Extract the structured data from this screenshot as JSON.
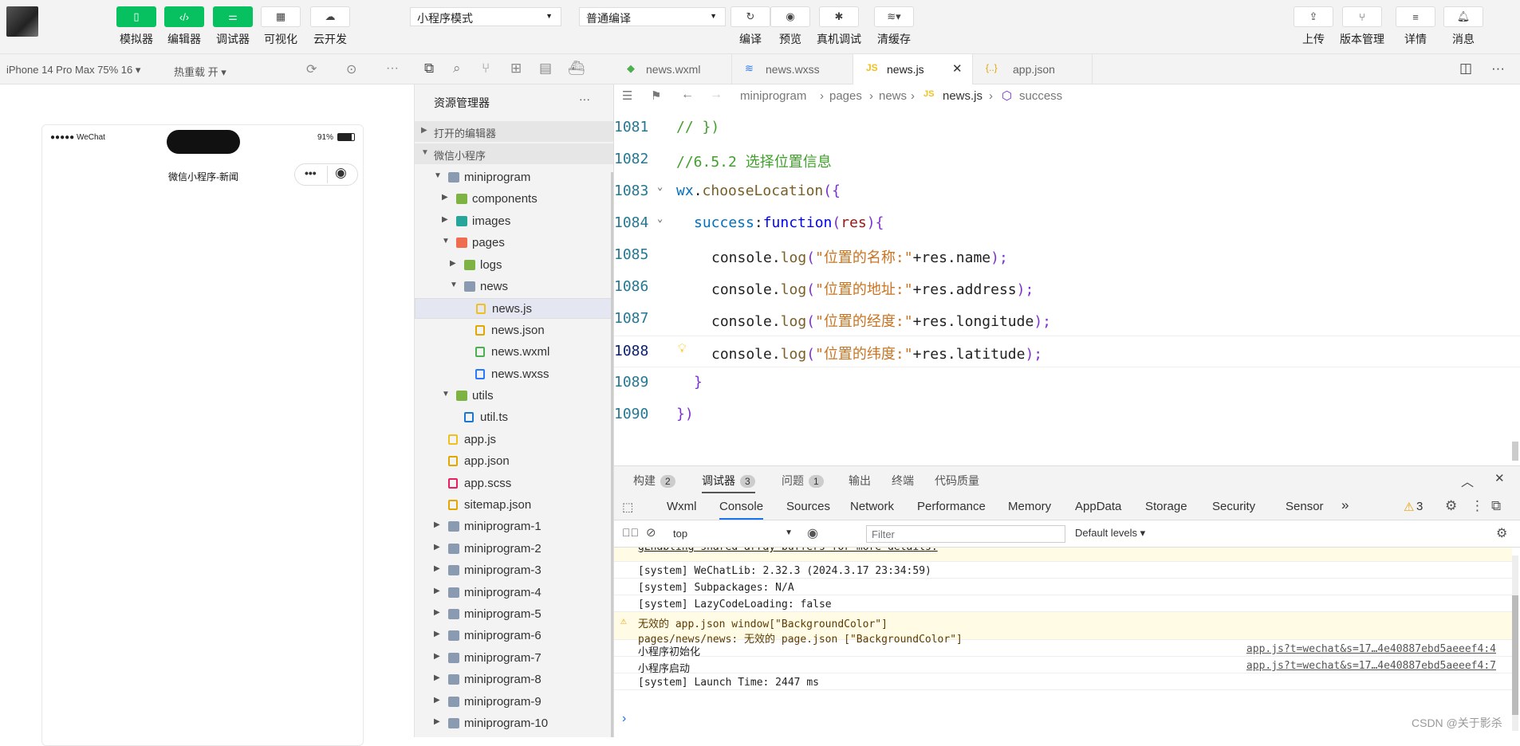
{
  "toolbar": {
    "simulator": "模拟器",
    "editor": "编辑器",
    "debugger": "调试器",
    "visual": "可视化",
    "cloud": "云开发",
    "mode": "小程序模式",
    "compile_mode": "普通编译",
    "compile": "编译",
    "preview": "预览",
    "remote_debug": "真机调试",
    "clear_cache": "清缓存",
    "upload": "上传",
    "version": "版本管理",
    "details": "详情",
    "messages": "消息"
  },
  "device_bar": {
    "device": "iPhone 14 Pro Max 75% 16 ▾",
    "hot_reload": "热重载 开 ▾"
  },
  "phone": {
    "carrier": "●●●●● WeChat",
    "battery": "91%",
    "title": "微信小程序-新闻",
    "menu": "•••"
  },
  "explorer": {
    "title": "资源管理器",
    "more": "···",
    "open_editors": "打开的编辑器",
    "project": "微信小程序",
    "items": [
      {
        "label": "miniprogram",
        "arrow": "▼",
        "icon": "folder"
      },
      {
        "label": "components",
        "arrow": "▶",
        "icon": "folder-green"
      },
      {
        "label": "images",
        "arrow": "▶",
        "icon": "folder-teal"
      },
      {
        "label": "pages",
        "arrow": "▼",
        "icon": "folder-red"
      },
      {
        "label": "logs",
        "arrow": "▶",
        "icon": "folder-green"
      },
      {
        "label": "news",
        "arrow": "▼",
        "icon": "folder"
      },
      {
        "label": "news.js",
        "arrow": "",
        "icon": "js"
      },
      {
        "label": "news.json",
        "arrow": "",
        "icon": "json"
      },
      {
        "label": "news.wxml",
        "arrow": "",
        "icon": "wxml"
      },
      {
        "label": "news.wxss",
        "arrow": "",
        "icon": "wxss"
      },
      {
        "label": "utils",
        "arrow": "▼",
        "icon": "folder-green"
      },
      {
        "label": "util.ts",
        "arrow": "",
        "icon": "ts"
      },
      {
        "label": "app.js",
        "arrow": "",
        "icon": "js"
      },
      {
        "label": "app.json",
        "arrow": "",
        "icon": "json"
      },
      {
        "label": "app.scss",
        "arrow": "",
        "icon": "scss"
      },
      {
        "label": "sitemap.json",
        "arrow": "",
        "icon": "json"
      },
      {
        "label": "miniprogram-1",
        "arrow": "▶",
        "icon": "folder"
      },
      {
        "label": "miniprogram-2",
        "arrow": "▶",
        "icon": "folder"
      },
      {
        "label": "miniprogram-3",
        "arrow": "▶",
        "icon": "folder"
      },
      {
        "label": "miniprogram-4",
        "arrow": "▶",
        "icon": "folder"
      },
      {
        "label": "miniprogram-5",
        "arrow": "▶",
        "icon": "folder"
      },
      {
        "label": "miniprogram-6",
        "arrow": "▶",
        "icon": "folder"
      },
      {
        "label": "miniprogram-7",
        "arrow": "▶",
        "icon": "folder"
      },
      {
        "label": "miniprogram-8",
        "arrow": "▶",
        "icon": "folder"
      },
      {
        "label": "miniprogram-9",
        "arrow": "▶",
        "icon": "folder"
      },
      {
        "label": "miniprogram-10",
        "arrow": "▶",
        "icon": "folder"
      }
    ]
  },
  "tabs": [
    {
      "label": "news.wxml"
    },
    {
      "label": "news.wxss"
    },
    {
      "label": "news.js"
    },
    {
      "label": "app.json"
    }
  ],
  "breadcrumb": {
    "p1": "miniprogram",
    "p2": "pages",
    "p3": "news",
    "p4": "news.js",
    "p5": "success"
  },
  "code": {
    "l1081": "1081",
    "l1082": "1082",
    "l1083": "1083",
    "l1084": "1084",
    "l1085": "1085",
    "l1086": "1086",
    "l1087": "1087",
    "l1088": "1088",
    "l1089": "1089",
    "l1090": "1090",
    "c1081": "// })",
    "c1082": "//6.5.2 选择位置信息",
    "wx": "wx",
    "dot": ".",
    "choose": "chooseLocation",
    "open": "({",
    "success": "success",
    "colon": ":",
    "function": "function",
    "paren": "(",
    "res": "res",
    "close_brace": "){",
    "console": "console",
    "log": "log",
    "lp": "(",
    "s1": "\"位置的名称:\"",
    "s2": "\"位置的地址:\"",
    "s3": "\"位置的经度:\"",
    "s4": "\"位置的纬度:\"",
    "plus_res": "+res.",
    "name": "name",
    "address": "address",
    "longitude": "longitude",
    "latitude": "latitude",
    "end": ");",
    "rbrace": "}",
    "rparen": "})"
  },
  "panel": {
    "build": "构建",
    "build_count": "2",
    "debugger": "调试器",
    "debugger_count": "3",
    "issues": "问题",
    "issues_count": "1",
    "output": "输出",
    "terminal": "终端",
    "quality": "代码质量",
    "devtabs": [
      "Wxml",
      "Console",
      "Sources",
      "Network",
      "Performance",
      "Memory",
      "AppData",
      "Storage",
      "Security",
      "Sensor"
    ],
    "more": "»",
    "warn_count": "3",
    "context": "top",
    "filter_placeholder": "Filter",
    "levels": "Default levels ▾",
    "logs": [
      {
        "text": "gEnabling shared-array-buffers for more details.",
        "src": ""
      },
      {
        "text": "[system] WeChatLib: 2.32.3 (2024.3.17 23:34:59)",
        "src": ""
      },
      {
        "text": "[system] Subpackages: N/A",
        "src": ""
      },
      {
        "text": "[system] LazyCodeLoading: false",
        "src": ""
      },
      {
        "text": "无效的 app.json window[\"BackgroundColor\"]\npages/news/news: 无效的 page.json [\"BackgroundColor\"]",
        "src": ""
      },
      {
        "text": "小程序初始化",
        "src": "app.js?t=wechat&s=17…4e40887ebd5aeeef4:4"
      },
      {
        "text": "小程序启动",
        "src": "app.js?t=wechat&s=17…4e40887ebd5aeeef4:7"
      },
      {
        "text": "[system] Launch Time: 2447 ms",
        "src": ""
      }
    ],
    "prompt": "›",
    "watermark": "CSDN @关于影杀"
  },
  "colors": {
    "accent": "#07c160",
    "warn_bg": "#fffbe5",
    "link": "#1a73e8"
  }
}
